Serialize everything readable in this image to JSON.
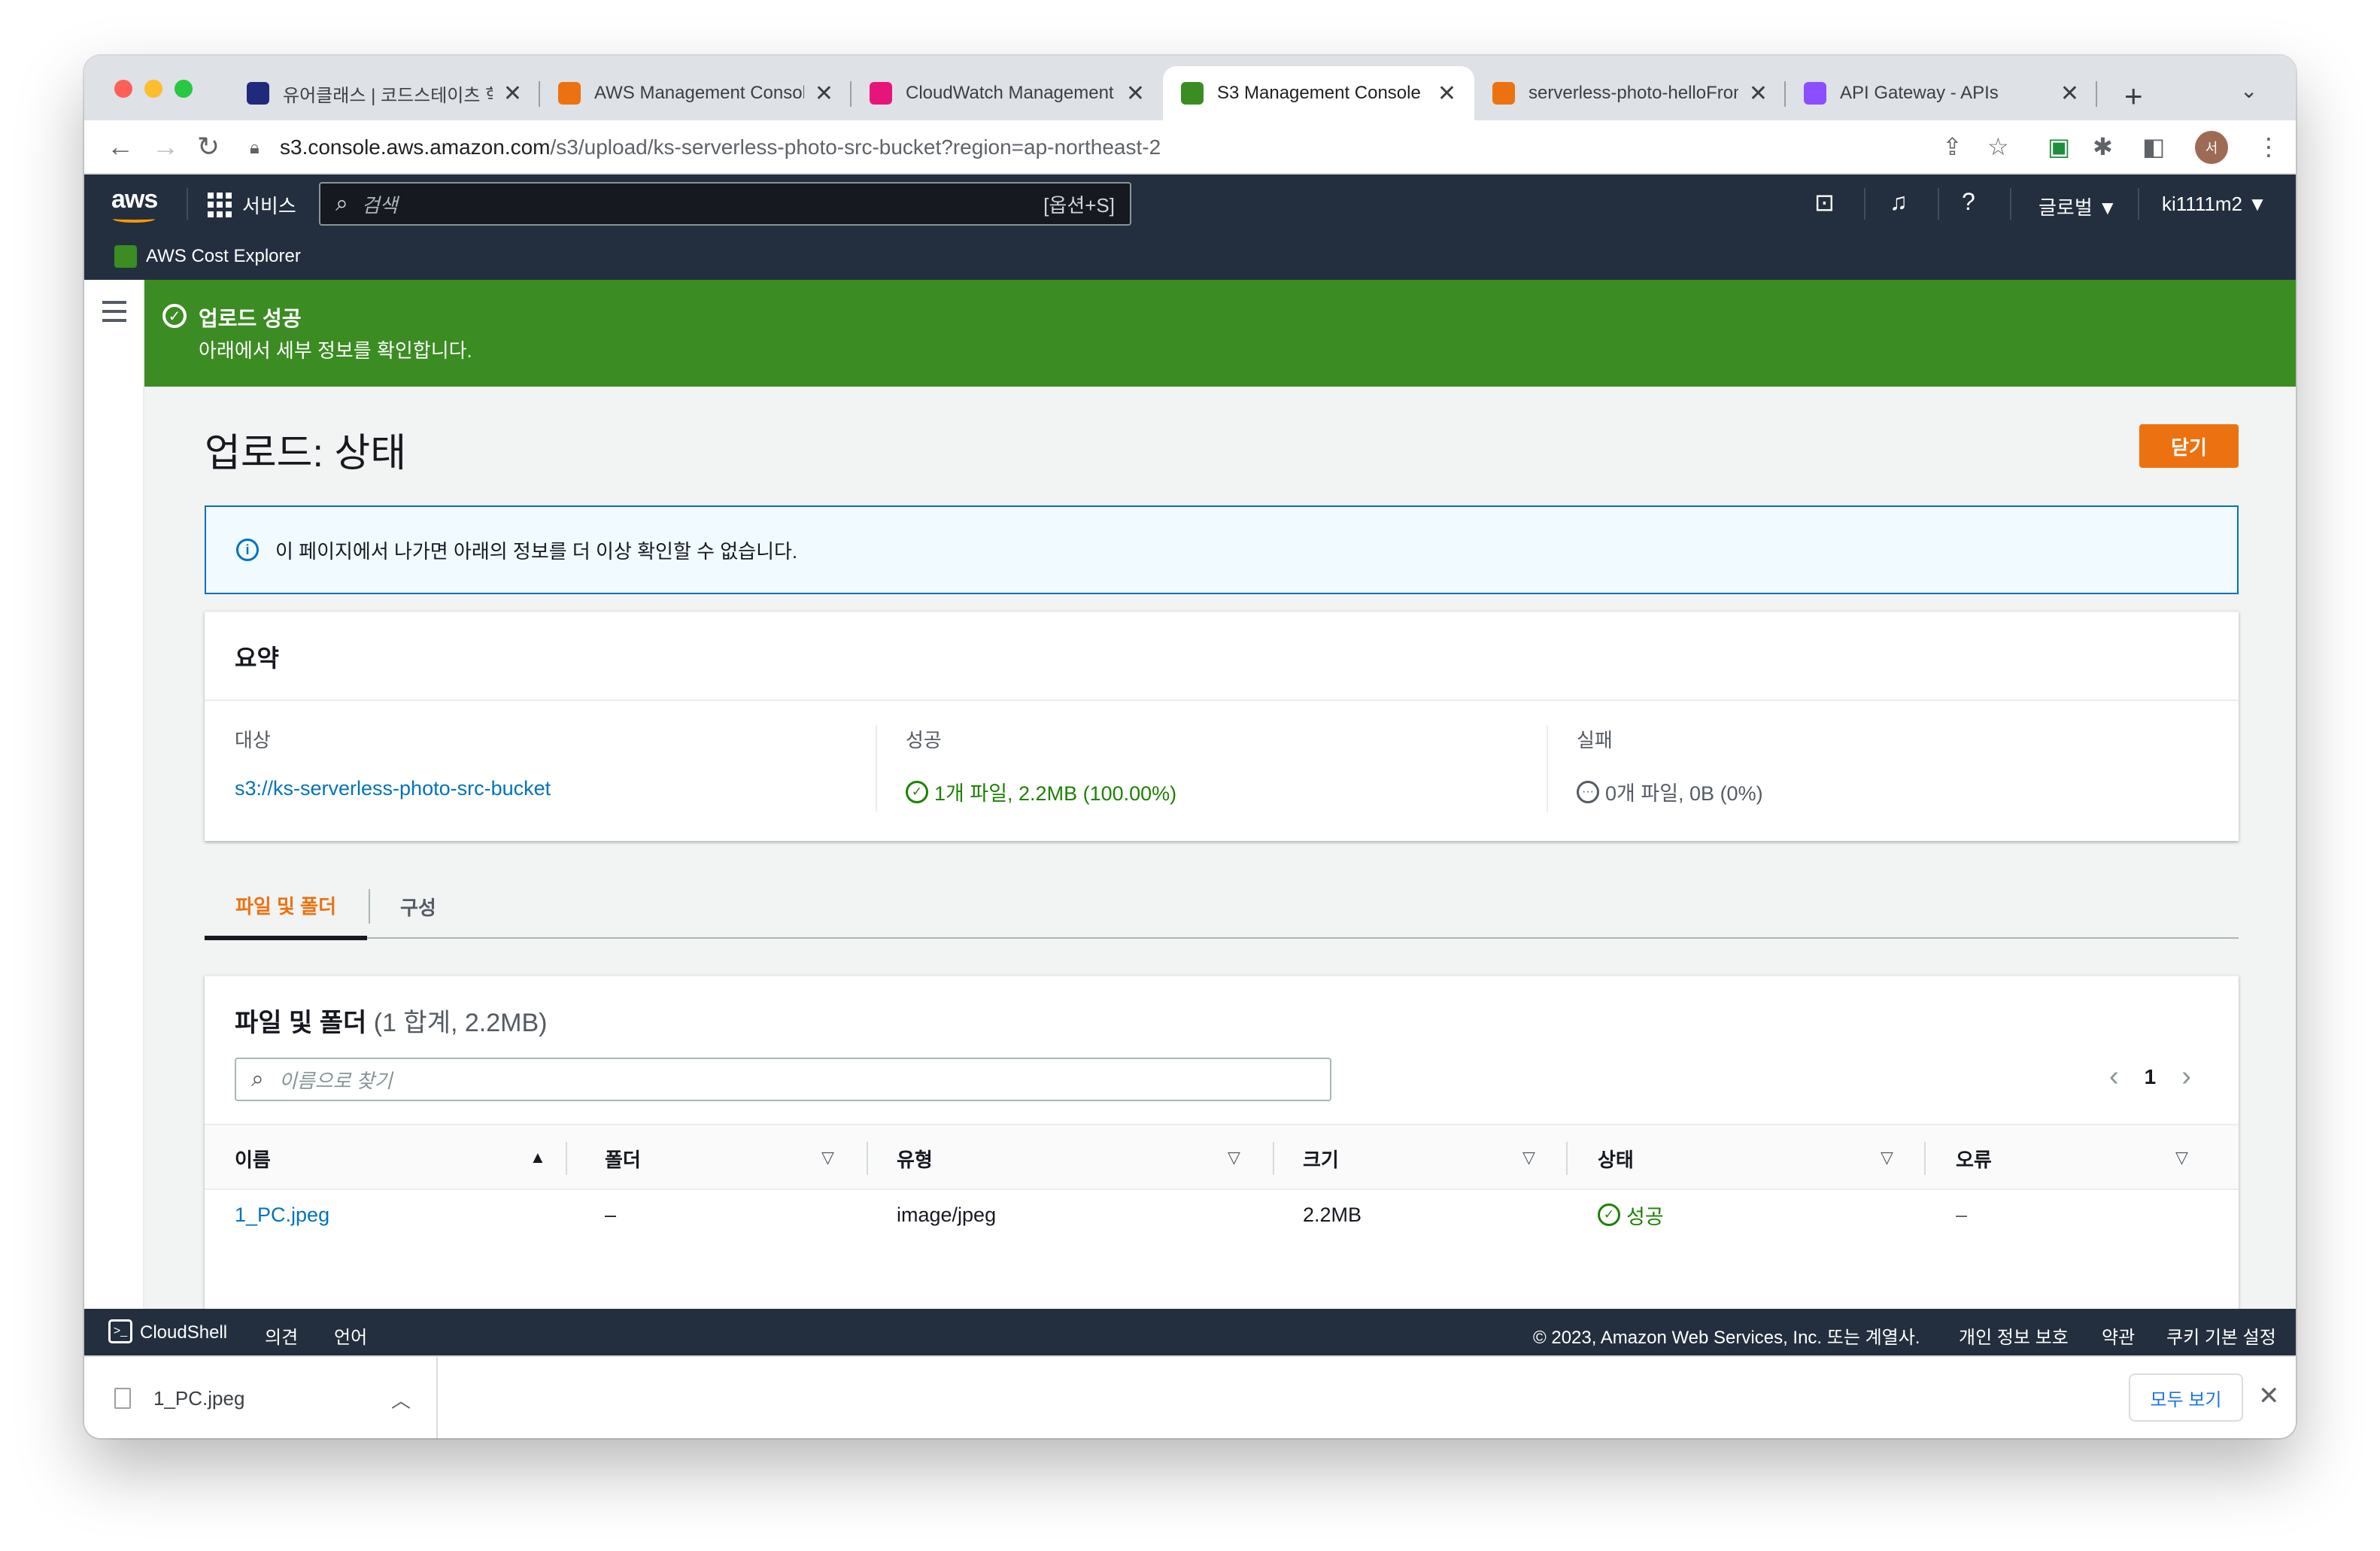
{
  "browser": {
    "tabs": [
      {
        "title": "유어클래스 | 코드스테이츠 학습",
        "favicon": "codestates",
        "color": "#1f2a7c",
        "active": false
      },
      {
        "title": "AWS Management Console",
        "favicon": "aws-cube",
        "color": "#ec7211",
        "active": false
      },
      {
        "title": "CloudWatch Management Console",
        "favicon": "cloudwatch",
        "color": "#e7157b",
        "active": false
      },
      {
        "title": "S3 Management Console",
        "favicon": "s3",
        "color": "#3b8c22",
        "active": true
      },
      {
        "title": "serverless-photo-helloFromLambda",
        "favicon": "lambda",
        "color": "#ec7211",
        "active": false
      },
      {
        "title": "API Gateway - APIs",
        "favicon": "api-gateway",
        "color": "#8c4fff",
        "active": false
      }
    ],
    "tab_close": "✕",
    "new_tab": "+",
    "tab_menu": "⌄",
    "url_domain": "s3.console.aws.amazon.com",
    "url_path": "/s3/upload/ks-serverless-photo-src-bucket?region=ap-northeast-2",
    "avatar": "서"
  },
  "aws_header": {
    "logo": "aws",
    "services": "서비스",
    "search_placeholder": "검색",
    "search_shortcut": "[옵션+S]",
    "region": "글로벌 ▼",
    "account": "ki1111m2 ▼",
    "favorite": "AWS Cost Explorer"
  },
  "flash": {
    "title": "업로드 성공",
    "body": "아래에서 세부 정보를 확인합니다."
  },
  "page": {
    "title": "업로드: 상태",
    "close_button": "닫기",
    "info": "이 페이지에서 나가면 아래의 정보를 더 이상 확인할 수 없습니다."
  },
  "summary": {
    "heading": "요약",
    "destination_label": "대상",
    "destination_value": "s3://ks-serverless-photo-src-bucket",
    "success_label": "성공",
    "success_value": "1개 파일, 2.2MB (100.00%)",
    "failure_label": "실패",
    "failure_value": "0개 파일, 0B (0%)"
  },
  "tabs": {
    "files": "파일 및 폴더",
    "config": "구성"
  },
  "files": {
    "title": "파일 및 폴더",
    "count": "(1 합계, 2.2MB)",
    "search_placeholder": "이름으로 찾기",
    "page": "1",
    "columns": [
      "이름",
      "폴더",
      "유형",
      "크기",
      "상태",
      "오류"
    ],
    "rows": [
      {
        "name": "1_PC.jpeg",
        "folder": "–",
        "type": "image/jpeg",
        "size": "2.2MB",
        "status": "성공",
        "error": "–"
      }
    ]
  },
  "footer": {
    "cloudshell": "CloudShell",
    "feedback": "의견",
    "language": "언어",
    "copyright": "© 2023, Amazon Web Services, Inc. 또는 계열사.",
    "privacy": "개인 정보 보호",
    "terms": "약관",
    "cookies": "쿠키 기본 설정"
  },
  "downloads": {
    "file": "1_PC.jpeg",
    "show_all": "모두 보기"
  }
}
